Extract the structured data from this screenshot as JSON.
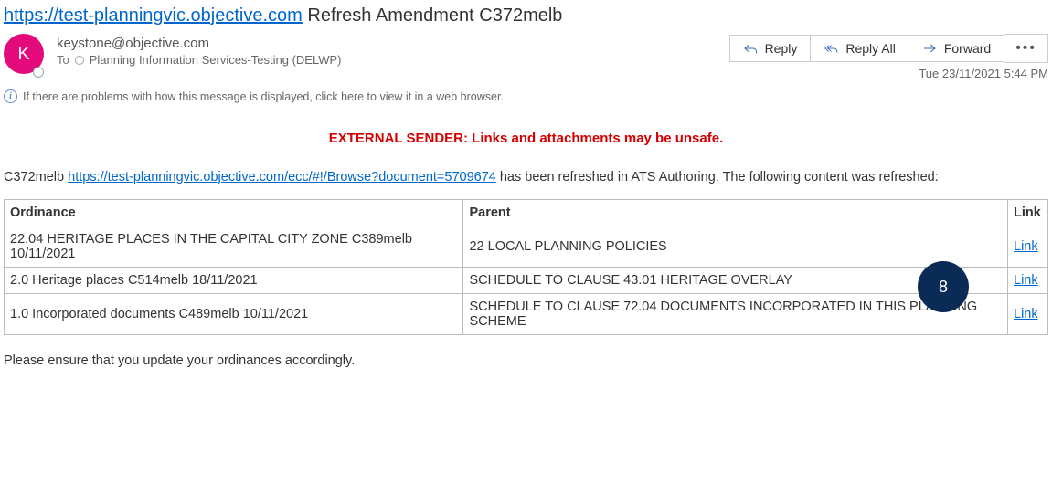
{
  "subject": {
    "link_text": "https://test-planningvic.objective.com",
    "rest": " Refresh Amendment C372melb"
  },
  "avatar_initial": "K",
  "from": "keystone@objective.com",
  "to_label": "To",
  "to_recipient": "Planning Information Services-Testing (DELWP)",
  "actions": {
    "reply": "Reply",
    "reply_all": "Reply All",
    "forward": "Forward",
    "more": "•••"
  },
  "timestamp": "Tue 23/11/2021 5:44 PM",
  "info_bar": "If there are problems with how this message is displayed, click here to view it in a web browser.",
  "warning": "EXTERNAL SENDER: Links and attachments may be unsafe.",
  "body_prefix": "C372melb ",
  "body_link": "https://test-planningvic.objective.com/ecc/#!/Browse?document=5709674",
  "body_suffix": " has been refreshed in ATS Authoring. The following content was refreshed:",
  "table": {
    "headers": {
      "col1": "Ordinance",
      "col2": "Parent",
      "col3": "Link"
    },
    "rows": [
      {
        "ordinance": "22.04 HERITAGE PLACES IN THE CAPITAL CITY ZONE C389melb 10/11/2021",
        "parent": "22 LOCAL PLANNING POLICIES",
        "link": "Link"
      },
      {
        "ordinance": "2.0 Heritage places C514melb 18/11/2021",
        "parent": "SCHEDULE TO CLAUSE 43.01 HERITAGE OVERLAY",
        "link": "Link"
      },
      {
        "ordinance": "1.0 Incorporated documents C489melb 10/11/2021",
        "parent": "SCHEDULE TO CLAUSE 72.04 DOCUMENTS INCORPORATED IN THIS PLANNING SCHEME",
        "link": "Link"
      }
    ]
  },
  "callout": "8",
  "footer_note": "Please ensure that you update your ordinances accordingly."
}
